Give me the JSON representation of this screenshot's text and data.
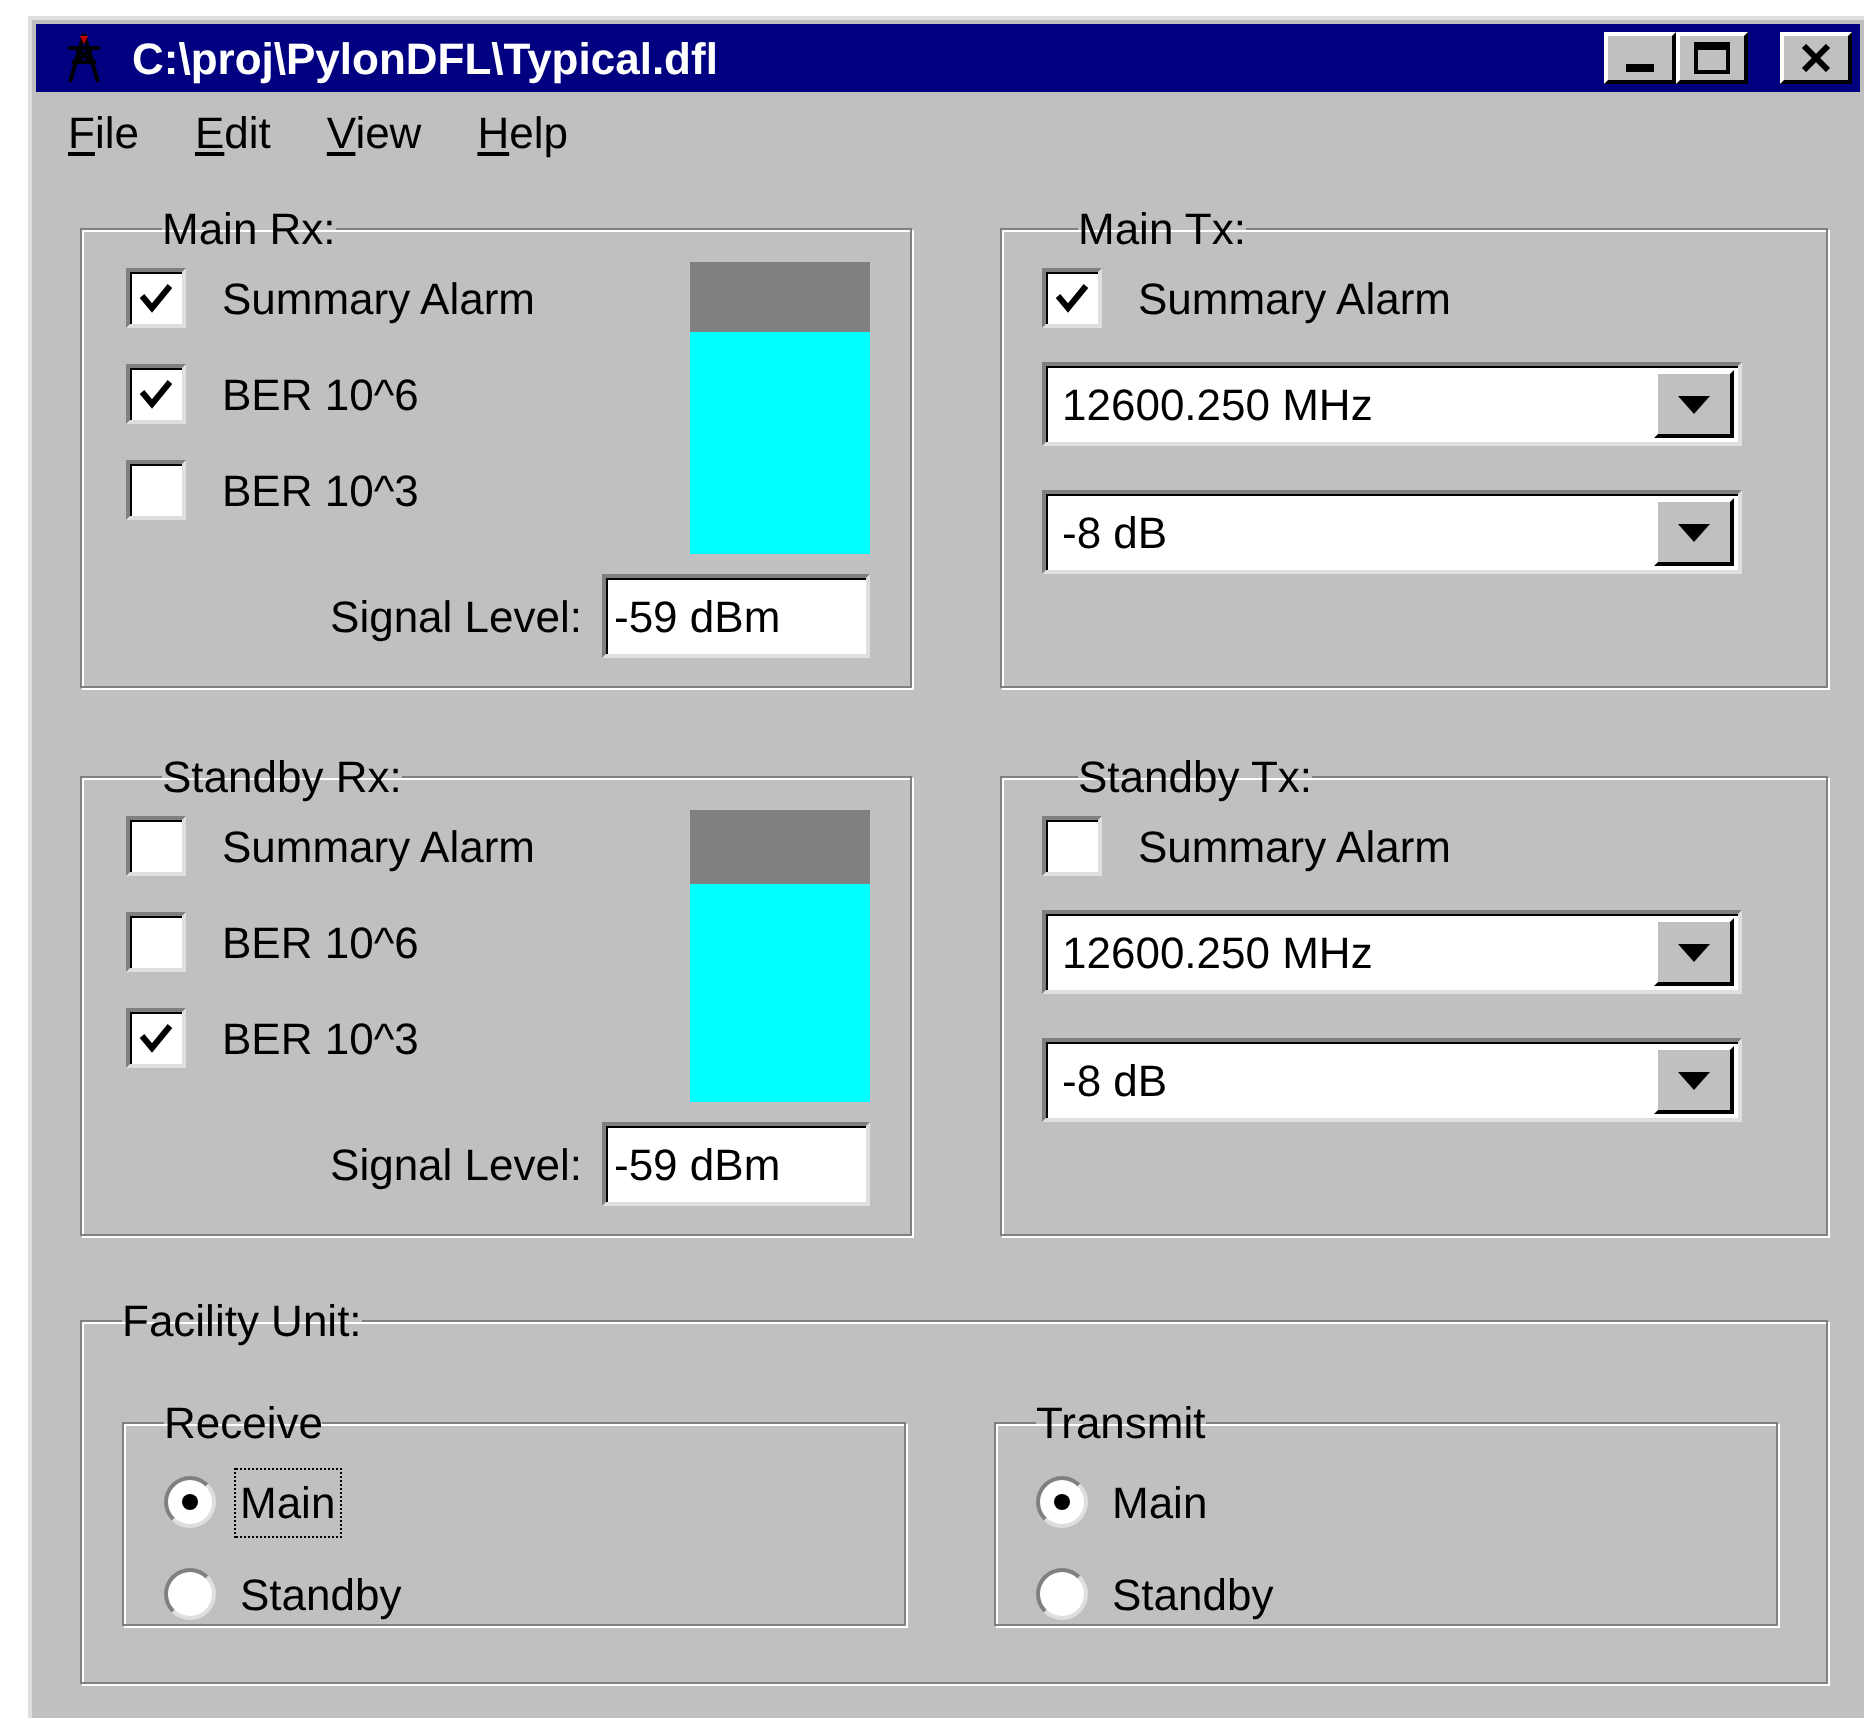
{
  "window": {
    "title": "C:\\proj\\PylonDFL\\Typical.dfl"
  },
  "menu": [
    {
      "label": "File",
      "underline_first": true
    },
    {
      "label": "Edit",
      "underline_first": true
    },
    {
      "label": "View",
      "underline_first": true
    },
    {
      "label": "Help",
      "underline_first": true
    }
  ],
  "rx_groups": [
    {
      "title": "Main Rx:",
      "checks": [
        {
          "label": "Summary Alarm",
          "checked": true
        },
        {
          "label": "BER 10^6",
          "checked": true
        },
        {
          "label": "BER 10^3",
          "checked": false
        }
      ],
      "meter": {
        "level": 0.76
      },
      "signal_label": "Signal Level:",
      "signal_value": "-59 dBm"
    },
    {
      "title": "Standby Rx:",
      "checks": [
        {
          "label": "Summary Alarm",
          "checked": false
        },
        {
          "label": "BER 10^6",
          "checked": false
        },
        {
          "label": "BER 10^3",
          "checked": true
        }
      ],
      "meter": {
        "level": 0.75
      },
      "signal_label": "Signal Level:",
      "signal_value": "-59 dBm"
    }
  ],
  "tx_groups": [
    {
      "title": "Main Tx:",
      "check": {
        "label": "Summary Alarm",
        "checked": true
      },
      "frequency": "12600.250 MHz",
      "attenuation": "-8 dB"
    },
    {
      "title": "Standby Tx:",
      "check": {
        "label": "Summary Alarm",
        "checked": false
      },
      "frequency": "12600.250 MHz",
      "attenuation": "-8 dB"
    }
  ],
  "facility": {
    "title": "Facility Unit:",
    "groups": [
      {
        "title": "Receive",
        "options": [
          {
            "label": "Main",
            "selected": true,
            "focused": true
          },
          {
            "label": "Standby",
            "selected": false,
            "focused": false
          }
        ]
      },
      {
        "title": "Transmit",
        "options": [
          {
            "label": "Main",
            "selected": true,
            "focused": false
          },
          {
            "label": "Standby",
            "selected": false,
            "focused": false
          }
        ]
      }
    ]
  }
}
